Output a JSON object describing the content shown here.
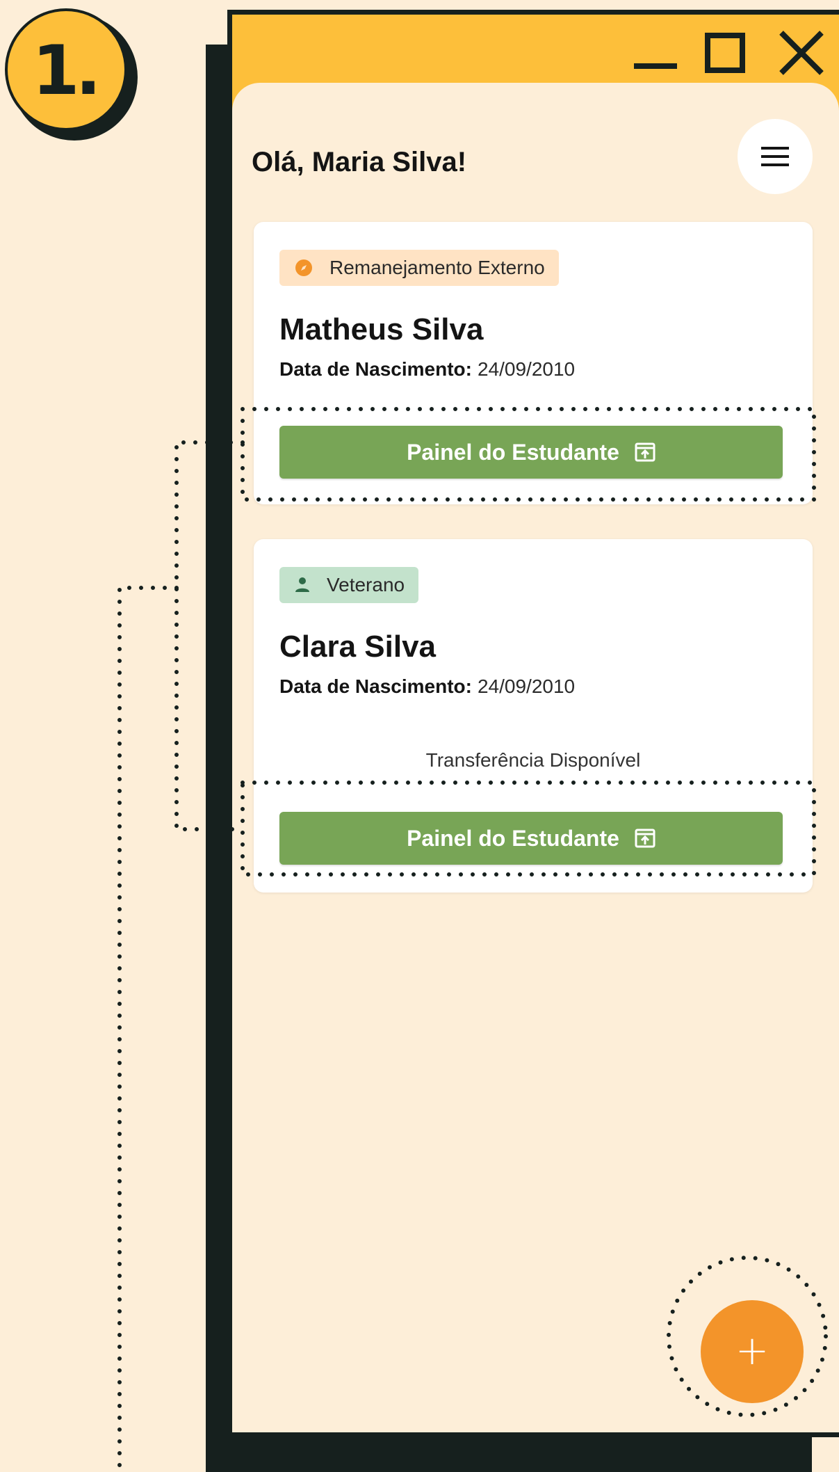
{
  "step": {
    "label": "1."
  },
  "window": {
    "controls": [
      "minimize",
      "maximize",
      "close"
    ]
  },
  "header": {
    "greeting": "Olá, Maria Silva!",
    "menu_icon": "hamburger-menu-icon"
  },
  "students": [
    {
      "tag": {
        "label": "Remanejamento Externo",
        "icon": "compass-icon",
        "color": "#ffe3c4"
      },
      "name": "Matheus Silva",
      "dob_label": "Data de Nascimento:",
      "dob_value": "24/09/2010",
      "button_label": "Painel do Estudante"
    },
    {
      "tag": {
        "label": "Veterano",
        "icon": "person-icon",
        "color": "#c3e2cc"
      },
      "name": "Clara Silva",
      "dob_label": "Data de Nascimento:",
      "dob_value": "24/09/2010",
      "transfer_text": "Transferência Disponível",
      "button_label": "Painel do Estudante"
    }
  ],
  "fab": {
    "label": "+",
    "icon": "plus-icon"
  },
  "colors": {
    "background": "#fdeed8",
    "accent_yellow": "#fdbf3a",
    "dark": "#16201e",
    "button_green": "#78a556",
    "fab_orange": "#f3942a"
  }
}
